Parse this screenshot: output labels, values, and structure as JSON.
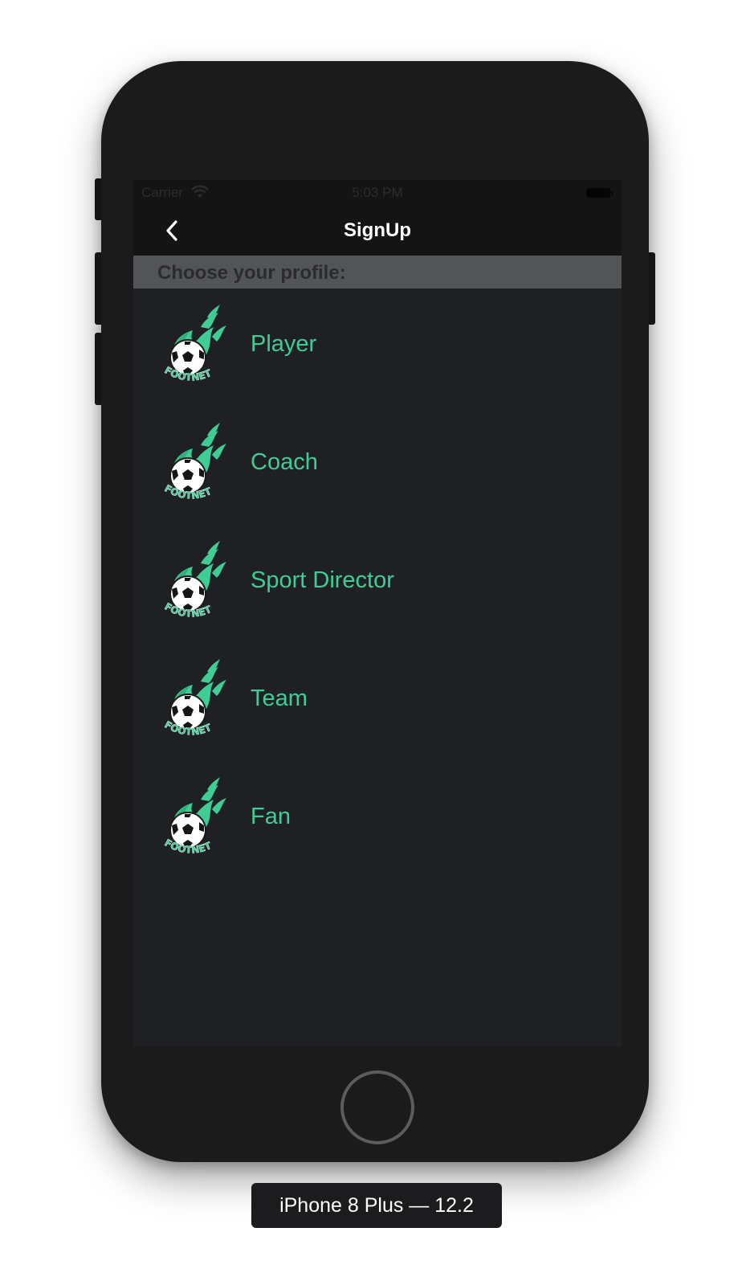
{
  "device": {
    "label": "iPhone 8 Plus — 12.2"
  },
  "status_bar": {
    "carrier": "Carrier",
    "time": "5:03 PM",
    "wifi_icon": "wifi-icon",
    "battery_icon": "battery-icon"
  },
  "nav": {
    "title": "SignUp",
    "back_icon": "chevron-left-icon"
  },
  "section": {
    "header": "Choose your profile:"
  },
  "profiles": [
    {
      "label": "Player",
      "logo_text": "FOOTNET"
    },
    {
      "label": "Coach",
      "logo_text": "FOOTNET"
    },
    {
      "label": "Sport Director",
      "logo_text": "FOOTNET"
    },
    {
      "label": "Team",
      "logo_text": "FOOTNET"
    },
    {
      "label": "Fan",
      "logo_text": "FOOTNET"
    }
  ],
  "colors": {
    "accent": "#3fcd95",
    "screen_background": "#1f2024",
    "navbar_background": "#141414",
    "section_header_background": "#525458",
    "device_body": "#1b1b1c"
  }
}
